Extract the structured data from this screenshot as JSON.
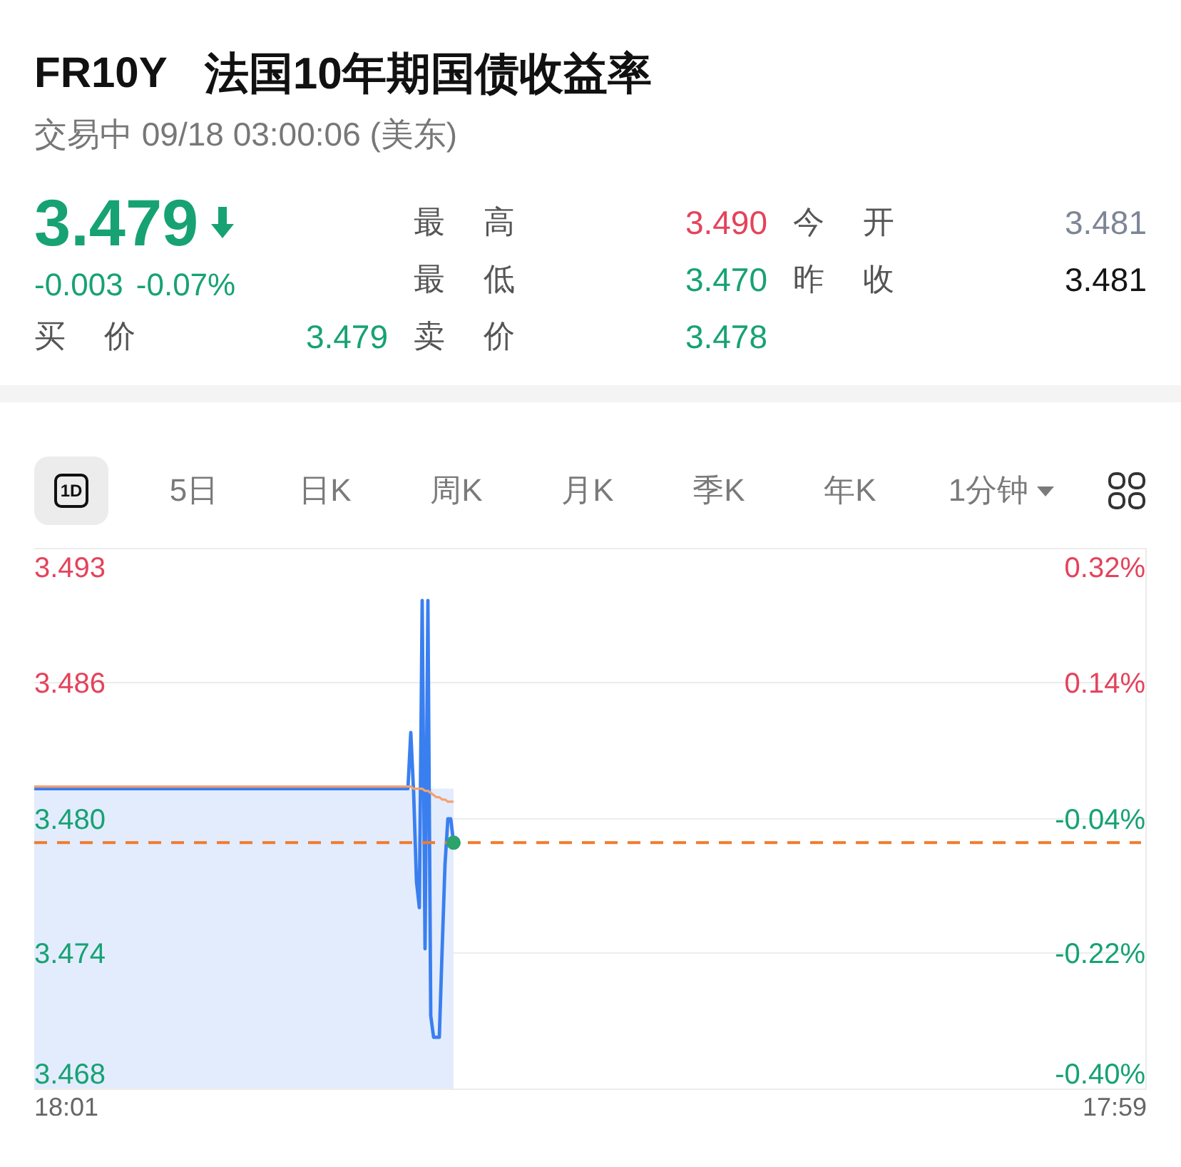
{
  "header": {
    "symbol": "FR10Y",
    "name": "法国10年期国债收益率",
    "status": "交易中 09/18 03:00:06 (美东)"
  },
  "quote": {
    "price": "3.479",
    "falling": true,
    "change": "-0.003",
    "change_percent": "-0.07%"
  },
  "bid": {
    "label": "买 价",
    "value": "3.479",
    "color": "#17a273"
  },
  "stats": [
    {
      "label": "最 高",
      "value": "3.490",
      "color": "#e4435b"
    },
    {
      "label": "今 开",
      "value": "3.481",
      "color": "#7d8597"
    },
    {
      "label": "最 低",
      "value": "3.470",
      "color": "#17a273"
    },
    {
      "label": "昨 收",
      "value": "3.481",
      "color": "#151515"
    },
    {
      "label": "卖 价",
      "value": "3.478",
      "color": "#17a273"
    }
  ],
  "periods": [
    {
      "label": "1D",
      "kind": "boxed",
      "selected": true
    },
    {
      "label": "5日",
      "kind": "text",
      "selected": false
    },
    {
      "label": "日K",
      "kind": "text",
      "selected": false
    },
    {
      "label": "周K",
      "kind": "text",
      "selected": false
    },
    {
      "label": "月K",
      "kind": "text",
      "selected": false
    },
    {
      "label": "季K",
      "kind": "text",
      "selected": false
    },
    {
      "label": "年K",
      "kind": "text",
      "selected": false
    },
    {
      "label": "1分钟",
      "kind": "dropdown",
      "selected": false
    }
  ],
  "chart": {
    "right_axis": [
      {
        "label": "0.32%",
        "color": "#e4435b"
      },
      {
        "label": "0.14%",
        "color": "#e4435b"
      },
      {
        "label": "-0.04%",
        "color": "#17a273"
      },
      {
        "label": "-0.22%",
        "color": "#17a273"
      },
      {
        "label": "-0.40%",
        "color": "#17a273"
      }
    ],
    "chart_data": {
      "type": "line",
      "categories": [
        null,
        null,
        null,
        null,
        null,
        null,
        null,
        null,
        null,
        null,
        null,
        null,
        null,
        null,
        null,
        null,
        null,
        null,
        null,
        null,
        null,
        null,
        null,
        null,
        null,
        null,
        null,
        null,
        null,
        null,
        null,
        null,
        null,
        null,
        null,
        null,
        null,
        null,
        null,
        null,
        null,
        null,
        null,
        null,
        null,
        null,
        null,
        null,
        null,
        null,
        null,
        null,
        null,
        null,
        null,
        null,
        null,
        null,
        null,
        null,
        null,
        null,
        null,
        null,
        null,
        null,
        null,
        null,
        null,
        null,
        null,
        null,
        null,
        null,
        null,
        null,
        null,
        null,
        null,
        null,
        null,
        null,
        null,
        null,
        null,
        null,
        null,
        null,
        null,
        null,
        null,
        null,
        null,
        null,
        null,
        null,
        null,
        null,
        null,
        null,
        null,
        null,
        null,
        null,
        null,
        null,
        null,
        null,
        null,
        null,
        null,
        null,
        null,
        null,
        null,
        null,
        null,
        null,
        null,
        null,
        null,
        null,
        null,
        null,
        null,
        null,
        null,
        null,
        null,
        null,
        null,
        null,
        null,
        null,
        null,
        null,
        null,
        null,
        null,
        null,
        null,
        null,
        null,
        null,
        null,
        null,
        null,
        null,
        null,
        null,
        null,
        null,
        null,
        null,
        null,
        null,
        null,
        null,
        null,
        null,
        null,
        null,
        null,
        null,
        null,
        null,
        null,
        null,
        null,
        null,
        null,
        null,
        null,
        null,
        null,
        null,
        null,
        null,
        null,
        null,
        null,
        null,
        null,
        null,
        null,
        null,
        null,
        null,
        null,
        null,
        null,
        null,
        null,
        null,
        null,
        null,
        null,
        null,
        null,
        null,
        null,
        null,
        null,
        null,
        null,
        null,
        null,
        null,
        null,
        null,
        null,
        null,
        null,
        null,
        null,
        null,
        null,
        null,
        null,
        null,
        null,
        null,
        null,
        null,
        null,
        null,
        null,
        null,
        null,
        null,
        null,
        null,
        null,
        null,
        null,
        null,
        null,
        null,
        null,
        null,
        null,
        null,
        null,
        null,
        null,
        null,
        null,
        null,
        null,
        null,
        null,
        null,
        null,
        null,
        null,
        null,
        null,
        null,
        null,
        null,
        null,
        null,
        null,
        null,
        null,
        null,
        null,
        null,
        null,
        null,
        null,
        null,
        null,
        null,
        null,
        null,
        null,
        null,
        null,
        null,
        null,
        null,
        null,
        null,
        null,
        null,
        null,
        null,
        null,
        null,
        null,
        null,
        null,
        null,
        null,
        null,
        null,
        null,
        null,
        null,
        null,
        null,
        null,
        null,
        null,
        null,
        null,
        null,
        null,
        null,
        null,
        null,
        null,
        null,
        null,
        null,
        null,
        null,
        null,
        null,
        null,
        null,
        null,
        null,
        null,
        null,
        null,
        null,
        null,
        null,
        null,
        null,
        null,
        null,
        null,
        null,
        null,
        null,
        null,
        null,
        null,
        null,
        null,
        null,
        null,
        null,
        null,
        null,
        null,
        null,
        null,
        null,
        null,
        null,
        null,
        null,
        null,
        null,
        null,
        null,
        null,
        null,
        null,
        null,
        null,
        null,
        null,
        null,
        null,
        null,
        null,
        null,
        null,
        null,
        null,
        null,
        null,
        null,
        null,
        null,
        null,
        null,
        null,
        null,
        null,
        null,
        null,
        null,
        null,
        null,
        null
      ],
      "series": [
        {
          "color": "#3a7ff0",
          "values": [
            3.4815,
            3.4815,
            3.4815,
            3.4815,
            3.4815,
            3.4815,
            3.4815,
            3.4815,
            3.4815,
            3.4815,
            3.4815,
            3.4815,
            3.4815,
            3.4815,
            3.4815,
            3.4815,
            3.4815,
            3.4815,
            3.4815,
            3.4815,
            3.4815,
            3.4815,
            3.4815,
            3.4815,
            3.4815,
            3.4815,
            3.4815,
            3.4815,
            3.4815,
            3.4815,
            3.4815,
            3.4815,
            3.4815,
            3.4815,
            3.4815,
            3.4815,
            3.4815,
            3.4815,
            3.4815,
            3.4815,
            3.4815,
            3.4815,
            3.4815,
            3.4815,
            3.4815,
            3.4815,
            3.4815,
            3.4815,
            3.4815,
            3.4815,
            3.4815,
            3.4815,
            3.4815,
            3.4815,
            3.4815,
            3.4815,
            3.4815,
            3.4815,
            3.4815,
            3.4815,
            3.4815,
            3.4815,
            3.4815,
            3.4815,
            3.4815,
            3.4815,
            3.4815,
            3.4815,
            3.4815,
            3.4815,
            3.4815,
            3.4815,
            3.4815,
            3.4815,
            3.4815,
            3.4815,
            3.4815,
            3.4815,
            3.4815,
            3.4815,
            3.4815,
            3.4815,
            3.4815,
            3.4815,
            3.4815,
            3.4815,
            3.4815,
            3.4815,
            3.4815,
            3.4815,
            3.4815,
            3.4815,
            3.4815,
            3.4815,
            3.4815,
            3.4815,
            3.4815,
            3.4815,
            3.4815,
            3.4815,
            3.4815,
            3.4815,
            3.4815,
            3.4815,
            3.4815,
            3.4815,
            3.4815,
            3.4815,
            3.4815,
            3.4815,
            3.4815,
            3.4815,
            3.4815,
            3.4815,
            3.4815,
            3.4815,
            3.4815,
            3.4815,
            3.4815,
            3.4815,
            3.4815,
            3.4815,
            3.4815,
            3.4815,
            3.4815,
            3.4815,
            3.4815,
            3.4815,
            3.4815,
            3.4815,
            3.4815,
            3.4815,
            3.4841,
            3.4813,
            3.4772,
            3.476,
            3.4902,
            3.4741,
            3.4902,
            3.471,
            3.47,
            3.47,
            3.47,
            3.4741,
            3.478,
            3.4801,
            3.4801,
            3.479,
            null,
            null,
            null,
            null,
            null,
            null,
            null,
            null,
            null,
            null,
            null,
            null,
            null,
            null,
            null,
            null,
            null,
            null,
            null,
            null,
            null,
            null,
            null,
            null,
            null,
            null,
            null,
            null,
            null,
            null,
            null,
            null,
            null,
            null,
            null,
            null,
            null,
            null,
            null,
            null,
            null,
            null,
            null,
            null,
            null,
            null,
            null,
            null,
            null,
            null,
            null,
            null,
            null,
            null,
            null,
            null,
            null,
            null,
            null,
            null,
            null,
            null,
            null,
            null,
            null,
            null,
            null,
            null,
            null,
            null,
            null,
            null,
            null,
            null,
            null,
            null,
            null,
            null,
            null,
            null,
            null,
            null,
            null,
            null,
            null,
            null,
            null,
            null,
            null,
            null,
            null,
            null,
            null,
            null,
            null,
            null,
            null,
            null,
            null,
            null,
            null,
            null,
            null,
            null,
            null,
            null,
            null,
            null,
            null,
            null,
            null,
            null,
            null,
            null,
            null,
            null,
            null,
            null,
            null,
            null,
            null,
            null,
            null,
            null,
            null,
            null,
            null,
            null,
            null,
            null,
            null,
            null,
            null,
            null,
            null,
            null,
            null,
            null,
            null,
            null,
            null,
            null,
            null,
            null,
            null,
            null,
            null,
            null,
            null,
            null,
            null,
            null,
            null,
            null,
            null,
            null,
            null,
            null,
            null,
            null,
            null,
            null,
            null,
            null,
            null,
            null,
            null,
            null,
            null,
            null,
            null,
            null,
            null,
            null,
            null,
            null,
            null,
            null,
            null,
            null,
            null,
            null,
            null,
            null,
            null,
            null,
            null,
            null,
            null,
            null,
            null,
            null,
            null,
            null,
            null,
            null,
            null,
            null,
            null,
            null,
            null,
            null,
            null,
            null,
            null,
            null,
            null,
            null,
            null,
            null,
            null,
            null,
            null,
            null,
            null,
            null,
            null,
            null,
            null,
            null,
            null,
            null,
            null,
            null,
            null,
            null,
            null,
            null,
            null,
            null,
            null,
            null,
            null,
            null,
            null,
            null,
            null,
            null,
            null,
            null,
            null,
            null,
            null
          ]
        },
        {
          "color": "#f2a272",
          "values": [
            3.4816,
            3.4816,
            3.4816,
            3.4816,
            3.4816,
            3.4816,
            3.4816,
            3.4816,
            3.4816,
            3.4816,
            3.4816,
            3.4816,
            3.4816,
            3.4816,
            3.4816,
            3.4816,
            3.4816,
            3.4816,
            3.4816,
            3.4816,
            3.4816,
            3.4816,
            3.4816,
            3.4816,
            3.4816,
            3.4816,
            3.4816,
            3.4816,
            3.4816,
            3.4816,
            3.4816,
            3.4816,
            3.4816,
            3.4816,
            3.4816,
            3.4816,
            3.4816,
            3.4816,
            3.4816,
            3.4816,
            3.4816,
            3.4816,
            3.4816,
            3.4816,
            3.4816,
            3.4816,
            3.4816,
            3.4816,
            3.4816,
            3.4816,
            3.4816,
            3.4816,
            3.4816,
            3.4816,
            3.4816,
            3.4816,
            3.4816,
            3.4816,
            3.4816,
            3.4816,
            3.4816,
            3.4816,
            3.4816,
            3.4816,
            3.4816,
            3.4816,
            3.4816,
            3.4816,
            3.4816,
            3.4816,
            3.4816,
            3.4816,
            3.4816,
            3.4816,
            3.4816,
            3.4816,
            3.4816,
            3.4816,
            3.4816,
            3.4816,
            3.4816,
            3.4816,
            3.4816,
            3.4816,
            3.4816,
            3.4816,
            3.4816,
            3.4816,
            3.4816,
            3.4816,
            3.4816,
            3.4816,
            3.4816,
            3.4816,
            3.4816,
            3.4816,
            3.4816,
            3.4816,
            3.4816,
            3.4816,
            3.4816,
            3.4816,
            3.4816,
            3.4816,
            3.4816,
            3.4816,
            3.4816,
            3.4816,
            3.4816,
            3.4816,
            3.4816,
            3.4816,
            3.4816,
            3.4816,
            3.4816,
            3.4816,
            3.4816,
            3.4816,
            3.4816,
            3.4816,
            3.4816,
            3.4816,
            3.4816,
            3.4816,
            3.4816,
            3.4816,
            3.4816,
            3.4816,
            3.4816,
            3.4816,
            3.4816,
            3.4816,
            3.4816,
            3.4815,
            3.4815,
            3.4815,
            3.4815,
            3.4814,
            3.4814,
            3.4813,
            3.4812,
            3.4811,
            3.4811,
            3.481,
            3.481,
            3.4809,
            3.4809,
            3.4809,
            null,
            null,
            null,
            null,
            null,
            null,
            null,
            null,
            null,
            null,
            null,
            null,
            null,
            null,
            null,
            null,
            null,
            null,
            null,
            null,
            null,
            null,
            null,
            null,
            null,
            null,
            null,
            null,
            null,
            null,
            null,
            null,
            null,
            null,
            null,
            null,
            null,
            null,
            null,
            null,
            null,
            null,
            null,
            null,
            null,
            null,
            null,
            null,
            null,
            null,
            null,
            null,
            null,
            null,
            null,
            null,
            null,
            null,
            null,
            null,
            null,
            null,
            null,
            null,
            null,
            null,
            null,
            null,
            null,
            null,
            null,
            null,
            null,
            null,
            null,
            null,
            null,
            null,
            null,
            null,
            null,
            null,
            null,
            null,
            null,
            null,
            null,
            null,
            null,
            null,
            null,
            null,
            null,
            null,
            null,
            null,
            null,
            null,
            null,
            null,
            null,
            null,
            null,
            null,
            null,
            null,
            null,
            null,
            null,
            null,
            null,
            null,
            null,
            null,
            null,
            null,
            null,
            null,
            null,
            null,
            null,
            null,
            null,
            null,
            null,
            null,
            null,
            null,
            null,
            null,
            null,
            null,
            null,
            null,
            null,
            null,
            null,
            null,
            null,
            null,
            null,
            null,
            null,
            null,
            null,
            null,
            null,
            null,
            null,
            null,
            null,
            null,
            null,
            null,
            null,
            null,
            null,
            null,
            null,
            null,
            null,
            null,
            null,
            null,
            null,
            null,
            null,
            null,
            null,
            null,
            null,
            null,
            null,
            null,
            null,
            null,
            null,
            null,
            null,
            null,
            null,
            null,
            null,
            null,
            null,
            null,
            null,
            null,
            null,
            null,
            null,
            null,
            null,
            null,
            null,
            null,
            null,
            null,
            null,
            null,
            null,
            null,
            null,
            null,
            null,
            null,
            null,
            null,
            null,
            null,
            null,
            null,
            null,
            null,
            null,
            null,
            null,
            null,
            null,
            null,
            null,
            null,
            null,
            null,
            null,
            null,
            null,
            null,
            null,
            null,
            null,
            null,
            null,
            null,
            null,
            null,
            null,
            null,
            null,
            null,
            null,
            null,
            null
          ]
        }
      ],
      "ylim": [
        3.4676,
        3.4926
      ],
      "yticks": [
        {
          "value": 3.4926,
          "label": "3.493"
        },
        {
          "value": 3.4864,
          "label": "3.486"
        },
        {
          "value": 3.4801,
          "label": "3.480"
        },
        {
          "value": 3.4739,
          "label": "3.474"
        },
        {
          "value": 3.4676,
          "label": "3.468"
        }
      ],
      "grid": true,
      "ref_lines": [
        {
          "axis": "y",
          "value": 3.479
        }
      ]
    },
    "time_axis": [
      "18:01",
      "17:59"
    ]
  }
}
